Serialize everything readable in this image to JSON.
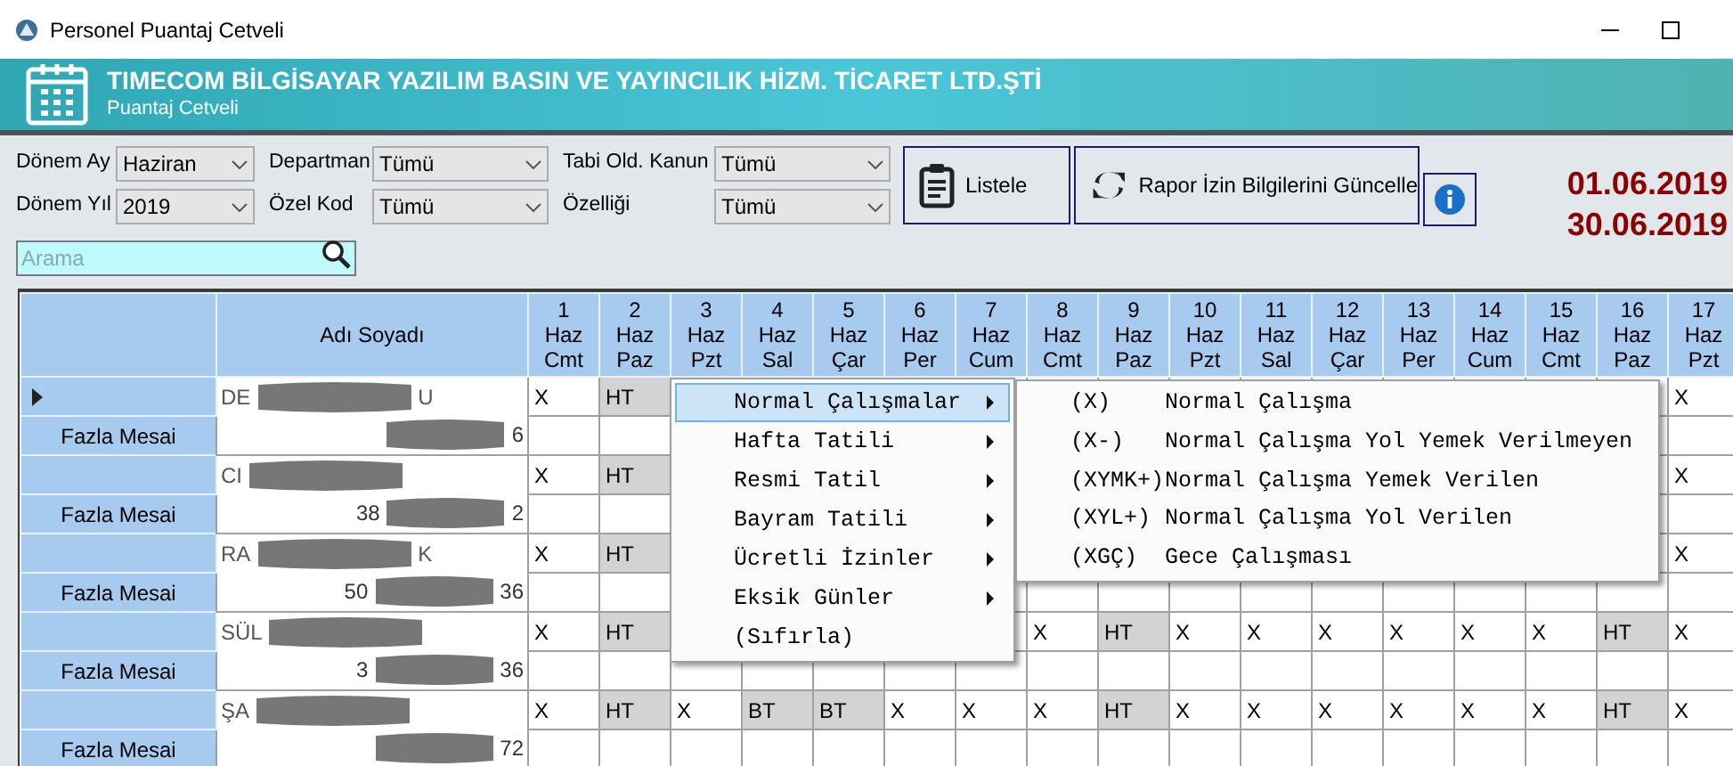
{
  "window": {
    "title": "Personel Puantaj Cetveli"
  },
  "header": {
    "title": "TIMECOM BİLGİSAYAR YAZILIM BASIN VE YAYINCILIK HİZM. TİCARET LTD.ŞTİ",
    "subtitle": "Puantaj Cetveli"
  },
  "filters": [
    {
      "label": "Dönem Ay",
      "value": "Haziran"
    },
    {
      "label": "Dönem Yıl",
      "value": "2019"
    },
    {
      "label": "Departman",
      "value": "Tümü"
    },
    {
      "label": "Özel Kod",
      "value": "Tümü"
    },
    {
      "label": "Tabi Old. Kanun",
      "value": "Tümü"
    },
    {
      "label": "Özelliği",
      "value": "Tümü"
    }
  ],
  "search": {
    "placeholder": "Arama"
  },
  "buttons": [
    {
      "kind": "list",
      "label": "Listele"
    },
    {
      "kind": "refresh",
      "label": "Rapor İzin Bilgilerini Güncelle"
    },
    {
      "kind": "info"
    }
  ],
  "date_range": {
    "start": "01.06.2019",
    "end": "30.06.2019"
  },
  "table": {
    "name_column": "Adı Soyadı",
    "days": [
      [
        "1",
        "Haz",
        "Cmt"
      ],
      [
        "2",
        "Haz",
        "Paz"
      ],
      [
        "3",
        "Haz",
        "Pzt"
      ],
      [
        "4",
        "Haz",
        "Sal"
      ],
      [
        "5",
        "Haz",
        "Çar"
      ],
      [
        "6",
        "Haz",
        "Per"
      ],
      [
        "7",
        "Haz",
        "Cum"
      ],
      [
        "8",
        "Haz",
        "Cmt"
      ],
      [
        "9",
        "Haz",
        "Paz"
      ],
      [
        "10",
        "Haz",
        "Pzt"
      ],
      [
        "11",
        "Haz",
        "Sal"
      ],
      [
        "12",
        "Haz",
        "Çar"
      ],
      [
        "13",
        "Haz",
        "Per"
      ],
      [
        "14",
        "Haz",
        "Cum"
      ],
      [
        "15",
        "Haz",
        "Cmt"
      ],
      [
        "16",
        "Haz",
        "Paz"
      ],
      [
        "17",
        "Haz",
        "Pzt"
      ]
    ],
    "rows": [
      {
        "current": true,
        "sub_label": "Fazla Mesai",
        "name_pieces": [
          "DE",
          "U"
        ],
        "id_pieces": [
          "6"
        ],
        "cells": [
          {
            "v": "X",
            "shaded": false
          },
          {
            "v": "HT",
            "shaded": true
          },
          null,
          null,
          null,
          null,
          null,
          null,
          null,
          null,
          null,
          null,
          null,
          null,
          null,
          null,
          {
            "v": "X",
            "shaded": false
          }
        ]
      },
      {
        "current": false,
        "sub_label": "Fazla Mesai",
        "name_pieces": [
          "CI"
        ],
        "id_pieces": [
          "38",
          "2"
        ],
        "cells": [
          {
            "v": "X",
            "shaded": false
          },
          {
            "v": "HT",
            "shaded": true
          },
          null,
          null,
          null,
          null,
          null,
          null,
          null,
          null,
          null,
          null,
          null,
          null,
          null,
          null,
          {
            "v": "X",
            "shaded": false
          }
        ]
      },
      {
        "current": false,
        "sub_label": "Fazla Mesai",
        "name_pieces": [
          "RA",
          "K"
        ],
        "id_pieces": [
          "50",
          "36"
        ],
        "cells": [
          {
            "v": "X",
            "shaded": false
          },
          {
            "v": "HT",
            "shaded": true
          },
          null,
          null,
          null,
          null,
          null,
          null,
          null,
          null,
          null,
          null,
          null,
          null,
          null,
          null,
          {
            "v": "X",
            "shaded": false
          }
        ]
      },
      {
        "current": false,
        "sub_label": "Fazla Mesai",
        "name_pieces": [
          "SÜL"
        ],
        "id_pieces": [
          "3",
          "36"
        ],
        "cells": [
          {
            "v": "X",
            "shaded": false
          },
          {
            "v": "HT",
            "shaded": true
          },
          null,
          null,
          null,
          null,
          null,
          {
            "v": "X",
            "shaded": false
          },
          {
            "v": "HT",
            "shaded": true
          },
          {
            "v": "X",
            "shaded": false
          },
          {
            "v": "X",
            "shaded": false
          },
          {
            "v": "X",
            "shaded": false
          },
          {
            "v": "X",
            "shaded": false
          },
          {
            "v": "X",
            "shaded": false
          },
          {
            "v": "X",
            "shaded": false
          },
          {
            "v": "HT",
            "shaded": true
          },
          {
            "v": "X",
            "shaded": false
          }
        ]
      },
      {
        "current": false,
        "sub_label": "Fazla Mesai",
        "name_pieces": [
          "ŞA"
        ],
        "id_pieces": [
          "72"
        ],
        "cells": [
          {
            "v": "X",
            "shaded": false
          },
          {
            "v": "HT",
            "shaded": true
          },
          {
            "v": "X",
            "shaded": false
          },
          {
            "v": "BT",
            "shaded": true
          },
          {
            "v": "BT",
            "shaded": true
          },
          {
            "v": "X",
            "shaded": false
          },
          {
            "v": "X",
            "shaded": false
          },
          {
            "v": "X",
            "shaded": false
          },
          {
            "v": "HT",
            "shaded": true
          },
          {
            "v": "X",
            "shaded": false
          },
          {
            "v": "X",
            "shaded": false
          },
          {
            "v": "X",
            "shaded": false
          },
          {
            "v": "X",
            "shaded": false
          },
          {
            "v": "X",
            "shaded": false
          },
          {
            "v": "X",
            "shaded": false
          },
          {
            "v": "HT",
            "shaded": true
          },
          {
            "v": "X",
            "shaded": false
          }
        ]
      }
    ]
  },
  "context_menu": {
    "items": [
      {
        "label": "Normal Çalışmalar",
        "submenu": true,
        "highlighted": true
      },
      {
        "label": "Hafta Tatili",
        "submenu": true,
        "highlighted": false
      },
      {
        "label": "Resmi Tatil",
        "submenu": true,
        "highlighted": false
      },
      {
        "label": "Bayram Tatili",
        "submenu": true,
        "highlighted": false
      },
      {
        "label": "Ücretli İzinler",
        "submenu": true,
        "highlighted": false
      },
      {
        "label": "Eksik Günler",
        "submenu": true,
        "highlighted": false
      },
      {
        "label": "(Sıfırla)",
        "submenu": false,
        "highlighted": false
      }
    ],
    "submenu": [
      {
        "code": "(X)",
        "label": "Normal Çalışma"
      },
      {
        "code": "(X-)",
        "label": "Normal Çalışma Yol Yemek Verilmeyen"
      },
      {
        "code": "(XYMK+)",
        "label": "Normal Çalışma Yemek Verilen"
      },
      {
        "code": "(XYL+)",
        "label": "Normal Çalışma Yol Verilen"
      },
      {
        "code": "(XGÇ)",
        "label": "Gece Çalışması"
      }
    ]
  }
}
